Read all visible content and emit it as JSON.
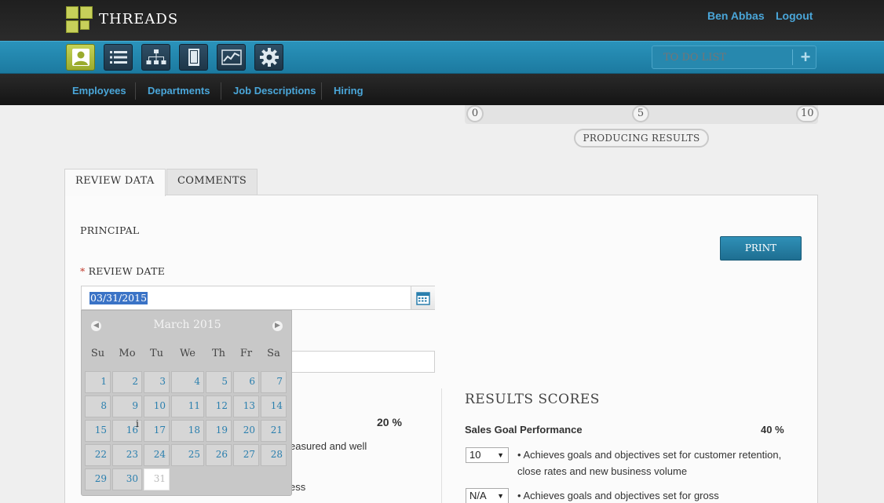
{
  "header": {
    "brand": "THREADS",
    "user_name": "Ben Abbas",
    "logout": "Logout"
  },
  "toolbar": {
    "icons": [
      "user-icon",
      "list-icon",
      "org-chart-icon",
      "document-icon",
      "chart-icon",
      "gear-icon"
    ],
    "todo_placeholder": "TO DO LIST",
    "todo_add": "+"
  },
  "subnav": {
    "items": [
      "Employees",
      "Departments",
      "Job Descriptions",
      "Hiring"
    ]
  },
  "scale": {
    "marks": [
      "0",
      "5",
      "10"
    ],
    "label": "PRODUCING RESULTS"
  },
  "tabs": [
    "REVIEW DATA",
    "COMMENTS"
  ],
  "form": {
    "principal": "PRINCIPAL",
    "print": "PRINT",
    "review_date_label": "REVIEW DATE",
    "required_marker": "*",
    "review_date_value": "03/31/2015"
  },
  "datepicker": {
    "title": "March 2015",
    "weekdays": [
      "Su",
      "Mo",
      "Tu",
      "We",
      "Th",
      "Fr",
      "Sa"
    ],
    "weeks": [
      [
        "1",
        "2",
        "3",
        "4",
        "5",
        "6",
        "7"
      ],
      [
        "8",
        "9",
        "10",
        "11",
        "12",
        "13",
        "14"
      ],
      [
        "15",
        "16",
        "17",
        "18",
        "19",
        "20",
        "21"
      ],
      [
        "22",
        "23",
        "24",
        "25",
        "26",
        "27",
        "28"
      ],
      [
        "29",
        "30",
        "31"
      ]
    ],
    "selected": "31"
  },
  "left_section": {
    "percent": "20 %",
    "text_line1": "easured and well",
    "text_line2": "ess",
    "cursor_glyph": "i"
  },
  "results": {
    "title": "RESULTS SCORES",
    "category": "Sales Goal Performance",
    "category_percent": "40 %",
    "items": [
      {
        "score": "10",
        "text": "• Achieves goals and objectives set for customer retention, close rates and new business volume"
      },
      {
        "score": "N/A",
        "text": "• Achieves goals and objectives set for gross"
      }
    ]
  },
  "colors": {
    "accent_blue": "#2a93bb",
    "link_blue": "#4aa6d9",
    "active_green": "#c5d357"
  }
}
